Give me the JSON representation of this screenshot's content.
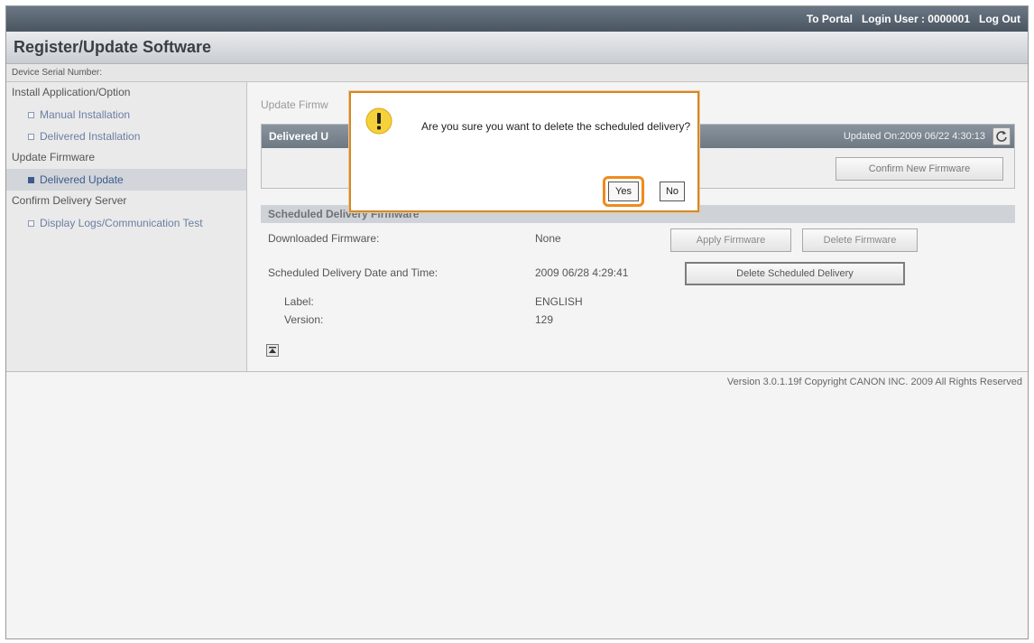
{
  "header": {
    "to_portal": "To Portal",
    "login_user": "Login User : 0000001",
    "logout": "Log Out",
    "title": "Register/Update Software",
    "serial_label": "Device Serial Number:"
  },
  "sidebar": {
    "sections": [
      {
        "heading": "Install Application/Option",
        "items": [
          {
            "label": "Manual Installation"
          },
          {
            "label": "Delivered Installation"
          }
        ]
      },
      {
        "heading": "Update Firmware",
        "items": [
          {
            "label": "Delivered Update",
            "active": true
          }
        ]
      },
      {
        "heading": "Confirm Delivery Server",
        "items": [
          {
            "label": "Display Logs/Communication Test"
          }
        ]
      }
    ]
  },
  "content": {
    "breadcrumb": "Update Firmw",
    "delivered_header": "Delivered U",
    "updated_on": "Updated On:2009 06/22 4:30:13",
    "confirm_new_button": "Confirm New Firmware",
    "scheduled_header": "Scheduled Delivery Firmware",
    "downloaded_label": "Downloaded Firmware:",
    "downloaded_value": "None",
    "apply_button": "Apply Firmware",
    "delete_fw_button": "Delete Firmware",
    "scheduled_label": "Scheduled Delivery Date and Time:",
    "scheduled_value": "2009 06/28 4:29:41",
    "delete_scheduled_button": "Delete Scheduled Delivery",
    "label_label": "Label:",
    "label_value": "ENGLISH",
    "version_label": "Version:",
    "version_value": "129"
  },
  "footer": {
    "copyright": "Version 3.0.1.19f Copyright CANON INC. 2009 All Rights Reserved"
  },
  "dialog": {
    "message": "Are you sure you want to delete the scheduled delivery?",
    "yes": "Yes",
    "no": "No"
  },
  "icons": {
    "warning": "warning-icon",
    "refresh": "refresh-icon",
    "scroll_top": "scroll-top-icon"
  },
  "colors": {
    "dialog_border": "#d08a2e",
    "highlight": "#f08a1c"
  }
}
